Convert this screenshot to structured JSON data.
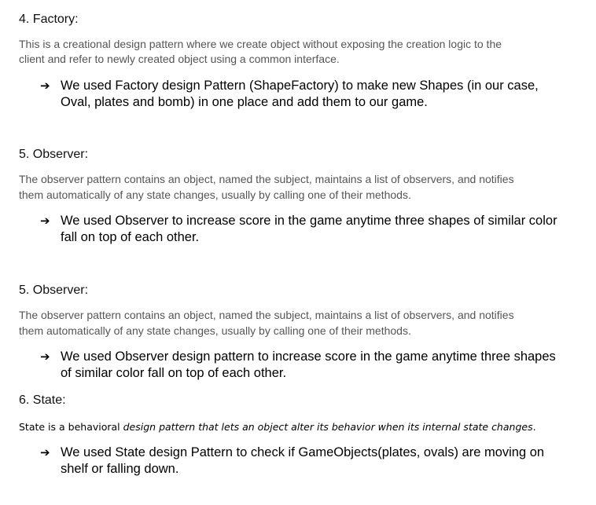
{
  "sections": {
    "factory": {
      "heading": "4. Factory:",
      "desc_line1": "This is a creational design pattern where we create object without exposing the creation logic to the",
      "desc_line2": "client and refer to newly created object using a common interface.",
      "bullet_line1": "We used Factory design Pattern (ShapeFactory) to make new Shapes (in our case,",
      "bullet_line2": "Oval, plates and bomb) in one place and add them to our game."
    },
    "observer1": {
      "heading": "5. Observer:",
      "desc_line1": "The observer pattern contains an object, named the subject, maintains a list of observers, and notifies",
      "desc_line2": "them automatically of any state changes, usually by calling one of their methods.",
      "bullet_line1": "We used Observer to increase score in the game anytime three shapes of similar color",
      "bullet_line2": "fall on top of each other."
    },
    "observer2": {
      "heading": "5. Observer:",
      "desc_line1": "The observer pattern contains an object, named the subject, maintains a list of observers, and notifies",
      "desc_line2": "them automatically of any state changes, usually by calling one of their methods.",
      "bullet_line1": "We used Observer design pattern to increase score in the game anytime three shapes",
      "bullet_line2": "of similar color fall on top of each other."
    },
    "state": {
      "heading": "6. State:",
      "desc_plain": "State is a behavioral ",
      "desc_italic": "design pattern that lets an object alter its behavior when its internal state changes",
      "desc_end": ".",
      "bullet_line1": "We used State design Pattern to check if GameObjects(plates, ovals) are moving on",
      "bullet_line2": "shelf or falling down."
    }
  },
  "bullet_arrow": "➔"
}
